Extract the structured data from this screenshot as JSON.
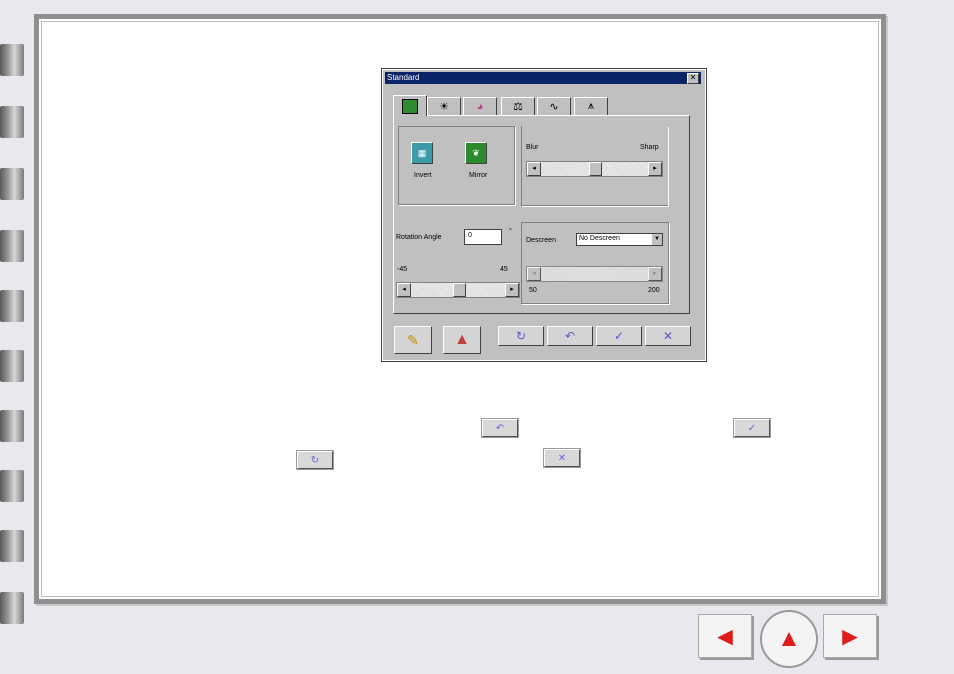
{
  "dialog": {
    "title": "Standard",
    "close_glyph": "✕",
    "tabs": [
      {
        "name": "image-tab-icon",
        "glyph": "▣",
        "active": true
      },
      {
        "name": "brightness-tab-icon",
        "glyph": "☀"
      },
      {
        "name": "color-wheel-tab-icon",
        "glyph": "◕"
      },
      {
        "name": "balance-tab-icon",
        "glyph": "⚖"
      },
      {
        "name": "curve-tab-icon",
        "glyph": "∿"
      },
      {
        "name": "histogram-tab-icon",
        "glyph": "⩚"
      }
    ],
    "invert_label": "Invert",
    "mirror_label": "Mirror",
    "blur_label": "Blur",
    "sharp_label": "Sharp",
    "rotation_label": "Rotation Angle",
    "rotation_value": "0",
    "degree_symbol": "°",
    "rotation_min": "-45",
    "rotation_max": "45",
    "descreen_label": "Descreen",
    "descreen_value": "No Descreen",
    "descreen_min": "50",
    "descreen_max": "200",
    "sharpness_level": 0.5,
    "rotation_level": 0.5
  },
  "icons": {
    "left": "◄",
    "right": "►",
    "refresh": "↻",
    "undo": "↶",
    "check": "✓",
    "cancel": "✕",
    "wand": "✎",
    "triangle": "▲",
    "home": "▲"
  },
  "colors": {
    "accent": "#e01b1b",
    "titlebar": "#0a246a",
    "button_icon": "#5358c8"
  }
}
